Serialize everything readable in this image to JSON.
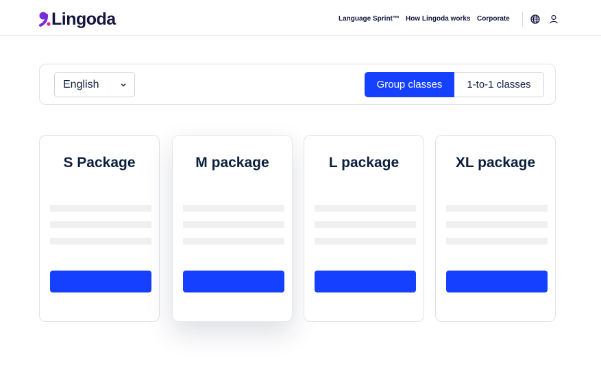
{
  "brand": {
    "name": "Lingoda",
    "accent": "#1640ff",
    "logo_mark_color": "#7a2bd9"
  },
  "nav": {
    "items": [
      {
        "label": "Language Sprint™"
      },
      {
        "label": "How Lingoda works"
      },
      {
        "label": "Corporate"
      }
    ],
    "icons": [
      "globe-icon",
      "user-icon"
    ]
  },
  "filters": {
    "language": {
      "value": "English",
      "icon": "chevron-down-icon"
    },
    "class_type": {
      "options": [
        {
          "label": "Group classes",
          "selected": true
        },
        {
          "label": "1-to-1 classes",
          "selected": false
        }
      ]
    }
  },
  "packages": [
    {
      "title": "S Package",
      "featured": false
    },
    {
      "title": "M package",
      "featured": true
    },
    {
      "title": "L package",
      "featured": false
    },
    {
      "title": "XL package",
      "featured": false
    }
  ]
}
